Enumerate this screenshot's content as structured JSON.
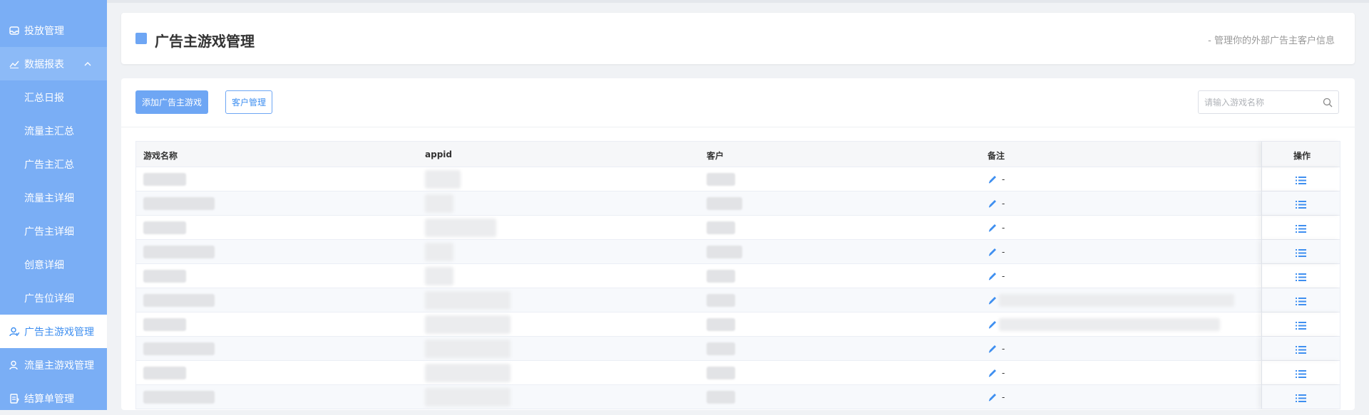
{
  "sidebar": {
    "items": [
      {
        "label": "投放管理",
        "icon": "inbox-icon"
      },
      {
        "label": "数据报表",
        "icon": "trend-chart-icon"
      },
      {
        "label": "汇总日报"
      },
      {
        "label": "流量主汇总"
      },
      {
        "label": "广告主汇总"
      },
      {
        "label": "流量主详细"
      },
      {
        "label": "广告主详细"
      },
      {
        "label": "创意详细"
      },
      {
        "label": "广告位详细"
      },
      {
        "label": "广告主游戏管理",
        "icon": "user-icon"
      },
      {
        "label": "流量主游戏管理",
        "icon": "user-icon"
      },
      {
        "label": "结算单管理",
        "icon": "document-icon"
      }
    ]
  },
  "header": {
    "title": "广告主游戏管理",
    "description": "- 管理你的外部广告主客户信息"
  },
  "toolbar": {
    "add_label": "添加广告主游戏",
    "customer_label": "客户管理",
    "search_placeholder": "请输入游戏名称"
  },
  "table": {
    "columns": [
      "游戏名称",
      "appid",
      "客户",
      "备注",
      "操作"
    ],
    "rows": [
      {
        "remark": "-"
      },
      {
        "remark": "-"
      },
      {
        "remark": "-"
      },
      {
        "remark": "-"
      },
      {
        "remark": "-"
      },
      {
        "remark": "-"
      },
      {
        "remark": "-"
      },
      {
        "remark": "-"
      },
      {
        "remark": "-"
      },
      {
        "remark": "-"
      }
    ]
  },
  "colors": {
    "sidebar_bg": "#7aaef5",
    "accent": "#3f8ff0",
    "primary_button": "#6ea6f4"
  }
}
